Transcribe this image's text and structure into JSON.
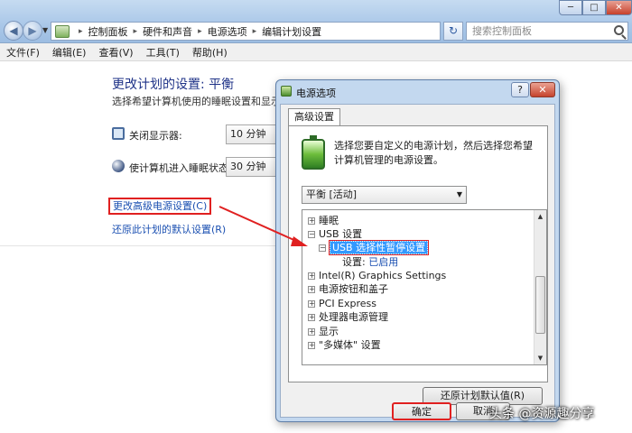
{
  "window": {
    "breadcrumb": [
      "控制面板",
      "硬件和声音",
      "电源选项",
      "编辑计划设置"
    ],
    "search_placeholder": "搜索控制面板",
    "buttons": {
      "minimize": "─",
      "maximize": "□",
      "close": "✕"
    }
  },
  "menu": [
    "文件(F)",
    "编辑(E)",
    "查看(V)",
    "工具(T)",
    "帮助(H)"
  ],
  "plan_settings": {
    "title": "更改计划的设置: 平衡",
    "description": "选择希望计算机使用的睡眠设置和显示设置。",
    "display_off_label": "关闭显示器:",
    "display_off_value": "10 分钟",
    "sleep_label": "使计算机进入睡眠状态:",
    "sleep_value": "30 分钟",
    "advanced_link": "更改高级电源设置(C)",
    "restore_link": "还原此计划的默认设置(R)"
  },
  "dialog": {
    "title": "电源选项",
    "tab": "高级设置",
    "description": "选择您要自定义的电源计划，然后选择您希望计算机管理的电源设置。",
    "plan_selected": "平衡 [活动]",
    "tree": [
      {
        "text": "睡眠",
        "expander": "+",
        "indent": 0
      },
      {
        "text": "USB 设置",
        "expander": "−",
        "indent": 0
      },
      {
        "text": "USB 选择性暂停设置",
        "expander": "−",
        "indent": 1,
        "selected": true
      },
      {
        "text": "设置:",
        "value": "已启用",
        "indent": 2
      },
      {
        "text": "Intel(R) Graphics Settings",
        "expander": "+",
        "indent": 0
      },
      {
        "text": "电源按钮和盖子",
        "expander": "+",
        "indent": 0
      },
      {
        "text": "PCI Express",
        "expander": "+",
        "indent": 0
      },
      {
        "text": "处理器电源管理",
        "expander": "+",
        "indent": 0
      },
      {
        "text": "显示",
        "expander": "+",
        "indent": 0
      },
      {
        "text": "\"多媒体\" 设置",
        "expander": "+",
        "indent": 0
      }
    ],
    "restore_defaults_button": "还原计划默认值(R)",
    "ok_button": "确定",
    "cancel_button": "取消",
    "help_button": "?",
    "close_button": "✕"
  },
  "watermark": "头条 @资源趣分享",
  "colors": {
    "highlight_red": "#e02020",
    "link_blue": "#1a4fb1",
    "selection_blue": "#3399ff"
  }
}
